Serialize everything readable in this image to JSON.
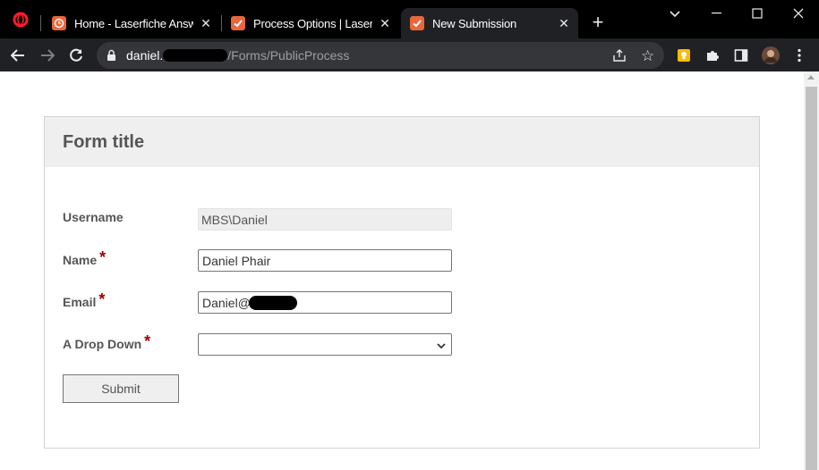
{
  "browser": {
    "tabs": [
      {
        "label": "Home - Laserfiche Answers",
        "favicon_color": "#e8673c",
        "favicon": "clock-icon"
      },
      {
        "label": "Process Options | Laserfiche",
        "favicon_color": "#e8673c",
        "favicon": "checkmark-icon"
      },
      {
        "label": "New Submission",
        "favicon_color": "#e8673c",
        "favicon": "checkmark-icon"
      }
    ],
    "url_host": "daniel.",
    "url_path": "/Forms/PublicProcess"
  },
  "form": {
    "title": "Form title",
    "fields": {
      "username": {
        "label": "Username",
        "value": "MBS\\Daniel"
      },
      "name": {
        "label": "Name",
        "value": "Daniel Phair",
        "required": "*"
      },
      "email": {
        "label": "Email",
        "value": "Daniel@",
        "required": "*"
      },
      "dropdown": {
        "label": "A Drop Down",
        "value": "",
        "required": "*"
      }
    },
    "submit_label": "Submit"
  },
  "colors": {
    "accent": "#e8673c",
    "required": "#a30000",
    "header_bg": "#efefef"
  }
}
